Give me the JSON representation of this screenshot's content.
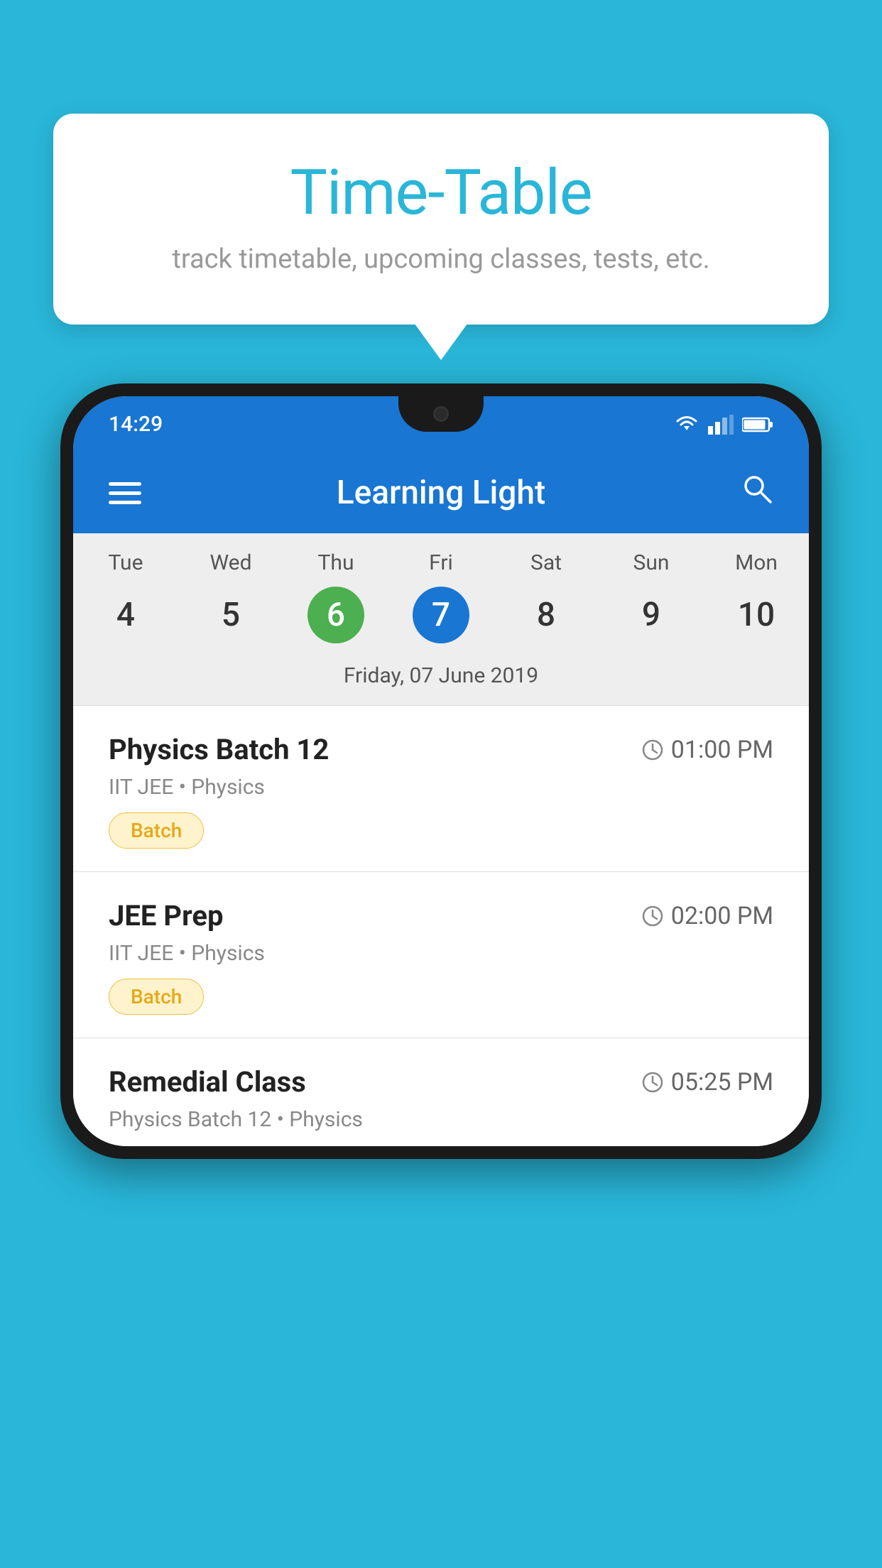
{
  "background_color": "#29B6D8",
  "tooltip": {
    "title": "Time-Table",
    "subtitle": "track timetable, upcoming classes, tests, etc."
  },
  "phone": {
    "status_bar": {
      "time": "14:29"
    },
    "app_bar": {
      "title": "Learning Light"
    },
    "calendar": {
      "days": [
        {
          "name": "Tue",
          "number": "4",
          "state": "normal"
        },
        {
          "name": "Wed",
          "number": "5",
          "state": "normal"
        },
        {
          "name": "Thu",
          "number": "6",
          "state": "today"
        },
        {
          "name": "Fri",
          "number": "7",
          "state": "selected"
        },
        {
          "name": "Sat",
          "number": "8",
          "state": "normal"
        },
        {
          "name": "Sun",
          "number": "9",
          "state": "normal"
        },
        {
          "name": "Mon",
          "number": "10",
          "state": "normal"
        }
      ],
      "selected_date_label": "Friday, 07 June 2019"
    },
    "classes": [
      {
        "name": "Physics Batch 12",
        "time": "01:00 PM",
        "meta": "IIT JEE • Physics",
        "badge": "Batch"
      },
      {
        "name": "JEE Prep",
        "time": "02:00 PM",
        "meta": "IIT JEE • Physics",
        "badge": "Batch"
      },
      {
        "name": "Remedial Class",
        "time": "05:25 PM",
        "meta": "Physics Batch 12 • Physics",
        "badge": null
      }
    ]
  }
}
